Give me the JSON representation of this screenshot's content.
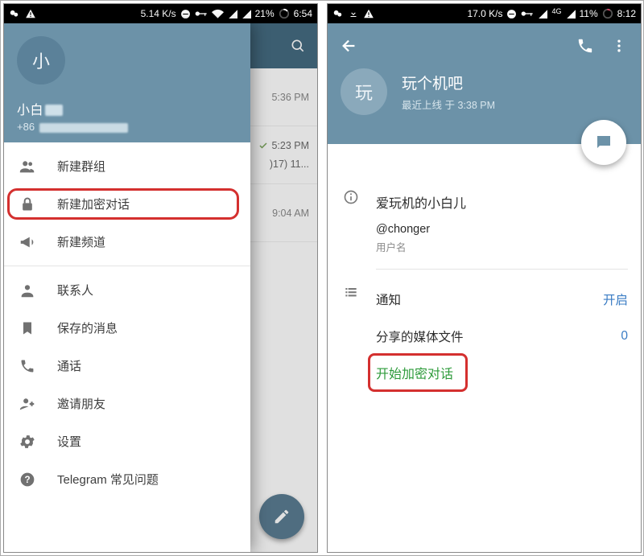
{
  "left": {
    "statusbar": {
      "speed": "5.14 K/s",
      "battery": "21%",
      "time": "6:54"
    },
    "drawer": {
      "avatar_letter": "小",
      "name_prefix": "小白",
      "phone_prefix": "+86 ",
      "menu": {
        "new_group": "新建群组",
        "new_secret_chat": "新建加密对话",
        "new_channel": "新建频道",
        "contacts": "联系人",
        "saved_messages": "保存的消息",
        "calls": "通话",
        "invite_friends": "邀请朋友",
        "settings": "设置",
        "faq": "Telegram 常见问题"
      }
    },
    "underlay": {
      "rows": [
        {
          "time": "5:36 PM"
        },
        {
          "time": "5:23 PM",
          "snippet": ")17) 11..."
        },
        {
          "time": "9:04 AM"
        }
      ]
    }
  },
  "right": {
    "statusbar": {
      "speed": "17.0 K/s",
      "net": "4G",
      "battery": "11%",
      "time": "8:12"
    },
    "profile": {
      "avatar_letter": "玩",
      "name": "玩个机吧",
      "last_seen": "最近上线 于 3:38 PM",
      "bio_title": "爱玩机的小白儿",
      "username": "@chonger",
      "username_caption": "用户名",
      "notifications_label": "通知",
      "notifications_value": "开启",
      "shared_media_label": "分享的媒体文件",
      "shared_media_value": "0",
      "start_secret_chat": "开始加密对话"
    }
  }
}
